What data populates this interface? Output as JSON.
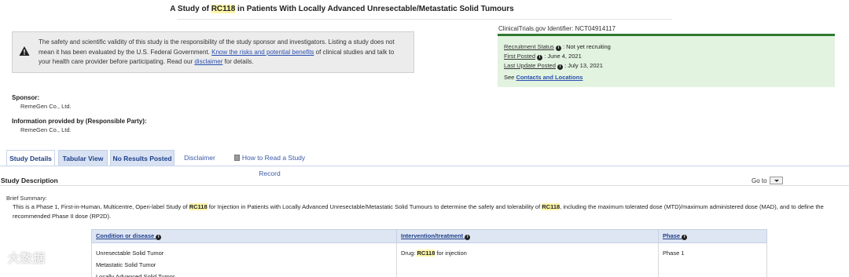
{
  "title": {
    "prefix": "A Study of ",
    "highlight": "RC118",
    "suffix": " in Patients With Locally Advanced Unresectable/Metastatic Solid Tumours"
  },
  "warning": {
    "text1": "The safety and scientific validity of this study is the responsibility of the study sponsor and investigators. Listing a study does not mean it has been evaluated by the U.S. Federal Government. ",
    "link1": "Know the risks and potential benefits",
    "text2": " of clinical studies and talk to your health care provider before participating. Read our ",
    "link2": "disclaimer",
    "text3": " for details."
  },
  "identifier": "ClinicalTrials.gov Identifier: NCT04914117",
  "status": {
    "recruitment_label": "Recruitment Status",
    "recruitment_value": ": Not yet recruiting",
    "first_posted_label": "First Posted",
    "first_posted_value": ": June 4, 2021",
    "last_update_label": "Last Update Posted",
    "last_update_value": ": July 13, 2021",
    "see": "See ",
    "contacts_link": "Contacts and Locations"
  },
  "sponsor": {
    "heading": "Sponsor:",
    "value": "RemeGen Co., Ltd."
  },
  "responsible": {
    "heading": "Information provided by (Responsible Party):",
    "value": "RemeGen Co., Ltd."
  },
  "tabs": {
    "study_details": "Study Details",
    "tabular_view": "Tabular View",
    "no_results": "No Results Posted",
    "disclaimer": "Disclaimer",
    "how_to_read": "How to Read a Study Record"
  },
  "study_description": {
    "title": "Study Description",
    "goto": "Go to"
  },
  "brief_summary": {
    "label": "Brief Summary:",
    "t1": "This is a Phase 1, First-in-Human, Multicentre, Open-label Study of ",
    "h1": "RC118",
    "t2": " for Injection in Patients with Locally Advanced Unresectable/Metastatic Solid Tumours to determine the safety and tolerability of ",
    "h2": "RC118",
    "t3": ", including the maximum tolerated dose (MTD)/maximum administered dose (MAD), and to define the recommended Phase II dose (RP2D)."
  },
  "table": {
    "col1": "Condition or disease",
    "col2": "Intervention/treatment",
    "col3": "Phase",
    "conditions": [
      "Unresectable Solid Tumor",
      "Metastatic Solid Tumor",
      "Locally Advanced Solid Tumor"
    ],
    "intervention_prefix": "Drug: ",
    "intervention_highlight": "RC118",
    "intervention_suffix": " for injection",
    "phase": "Phase 1"
  },
  "watermark": "大数据"
}
